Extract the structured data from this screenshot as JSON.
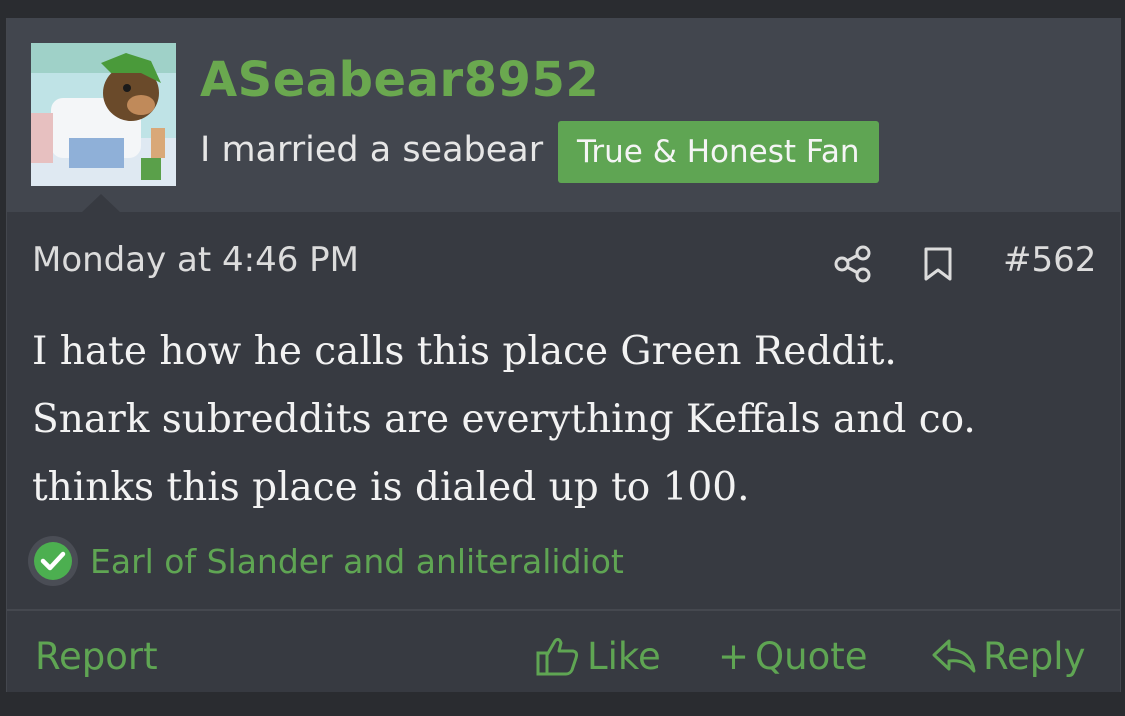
{
  "post": {
    "username": "ASeabear8952",
    "user_title": "I married a seabear",
    "badge": "True & Honest Fan",
    "date": "Monday at 4:46 PM",
    "post_number": "#562",
    "body_lines": [
      "I hate how he calls this place Green Reddit.",
      "Snark subreddits are everything Keffals and co.",
      "thinks this place is dialed up to 100."
    ],
    "reactions_text": "Earl of Slander and anliteralidiot"
  },
  "actions": {
    "report": "Report",
    "like": "Like",
    "quote": "Quote",
    "reply": "Reply"
  },
  "icons": {
    "share": "share-icon",
    "bookmark": "bookmark-icon",
    "reaction": "check-icon",
    "like": "thumbs-up-icon",
    "quote": "plus-icon",
    "reply": "reply-icon"
  },
  "colors": {
    "accent": "#5fa553",
    "username": "#6aa84f",
    "background": "#373a41",
    "header": "#42464e"
  }
}
